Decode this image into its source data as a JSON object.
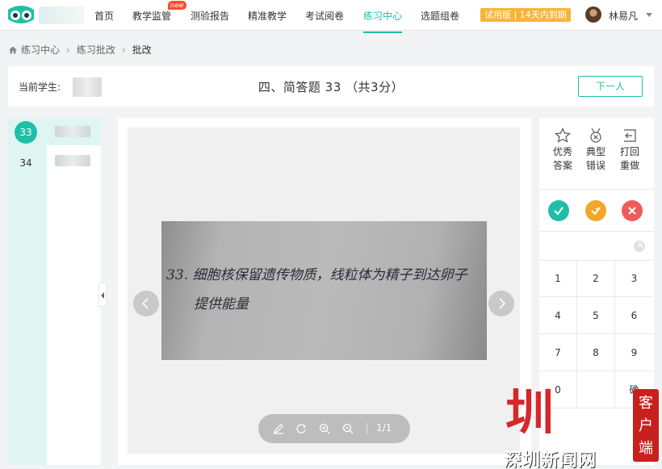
{
  "nav": {
    "items": [
      "首页",
      "教学监管",
      "测验报告",
      "精准教学",
      "考试阅卷",
      "练习中心",
      "选题组卷"
    ],
    "new_badge": "new",
    "trial": "试用版 | 14天内到期",
    "username": "林易凡"
  },
  "breadcrumb": [
    "练习中心",
    "练习批改",
    "批改"
  ],
  "header": {
    "student_label": "当前学生:",
    "question_title": "四、简答题 33 （共3分）",
    "next_button": "下一人"
  },
  "questions": [
    "33",
    "34"
  ],
  "answer_text": {
    "line1": "33. 细胞核保留遗传物质，线粒体为精子到达卵子",
    "line2": "提供能量"
  },
  "viewer": {
    "page": "1/1"
  },
  "tools": [
    {
      "label1": "优秀",
      "label2": "答案",
      "icon": "star-badge-icon"
    },
    {
      "label1": "典型",
      "label2": "错误",
      "icon": "error-medal-icon"
    },
    {
      "label1": "打回",
      "label2": "重做",
      "icon": "return-icon"
    }
  ],
  "keypad": [
    "1",
    "2",
    "3",
    "4",
    "5",
    "6",
    "7",
    "8",
    "9",
    "0",
    "",
    "确"
  ],
  "colors": {
    "accent": "#1ebfa8",
    "correct": "#1ebfa8",
    "partial": "#f4a62a",
    "wrong": "#f05a5a",
    "trial": "#f6b53a"
  },
  "watermark": {
    "big": "圳",
    "small": "深圳新闻网",
    "box": "客户端"
  }
}
